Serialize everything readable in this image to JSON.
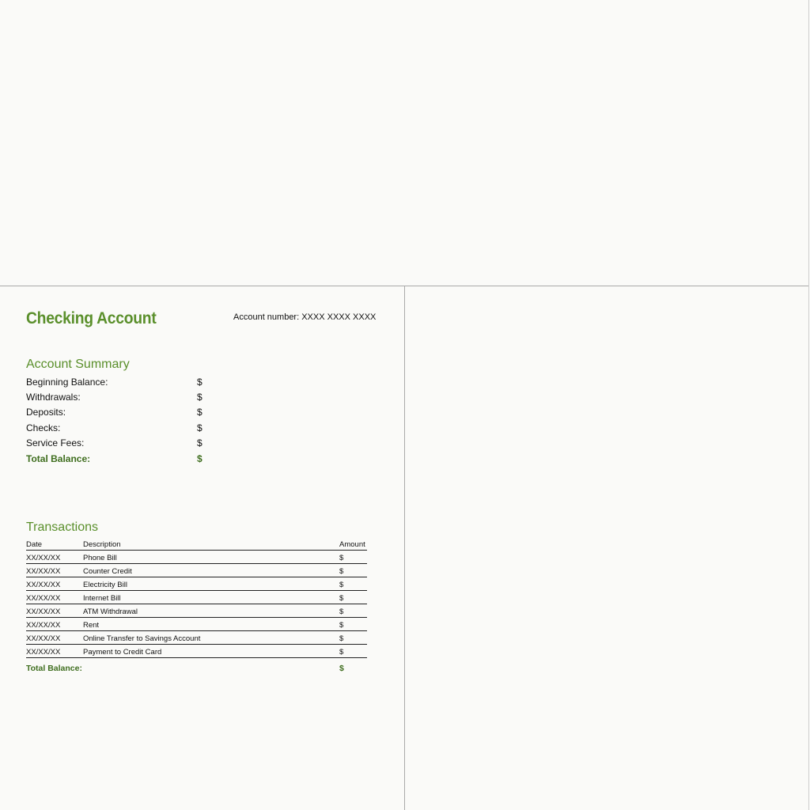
{
  "document": {
    "title": "Checking Account",
    "account_number": "Account number: XXXX XXXX XXXX"
  },
  "summary": {
    "heading": "Account Summary",
    "rows": [
      {
        "label": "Beginning Balance:",
        "value": "$"
      },
      {
        "label": "Withdrawals:",
        "value": "$"
      },
      {
        "label": "Deposits:",
        "value": "$"
      },
      {
        "label": "Checks:",
        "value": "$"
      },
      {
        "label": "Service Fees:",
        "value": "$"
      }
    ],
    "total": {
      "label": "Total Balance:",
      "value": "$"
    }
  },
  "transactions": {
    "heading": "Transactions",
    "columns": {
      "date": "Date",
      "description": "Description",
      "amount": "Amount"
    },
    "rows": [
      {
        "date": "XX/XX/XX",
        "description": "Phone Bill",
        "amount": "$"
      },
      {
        "date": "XX/XX/XX",
        "description": "Counter Credit",
        "amount": "$"
      },
      {
        "date": "XX/XX/XX",
        "description": "Electricity Bill",
        "amount": "$"
      },
      {
        "date": "XX/XX/XX",
        "description": "Internet Bill",
        "amount": "$"
      },
      {
        "date": "XX/XX/XX",
        "description": "ATM Withdrawal",
        "amount": "$"
      },
      {
        "date": "XX/XX/XX",
        "description": "Rent",
        "amount": "$"
      },
      {
        "date": "XX/XX/XX",
        "description": "Online Transfer to Savings Account",
        "amount": "$"
      },
      {
        "date": "XX/XX/XX",
        "description": "Payment to Credit Card",
        "amount": "$"
      }
    ],
    "total": {
      "label": "Total Balance:",
      "value": "$"
    }
  },
  "colors": {
    "accent": "#5a8f2b",
    "accent_dark": "#3f6e1f",
    "background": "#fafaf8",
    "gridline": "#a9a9a9"
  }
}
